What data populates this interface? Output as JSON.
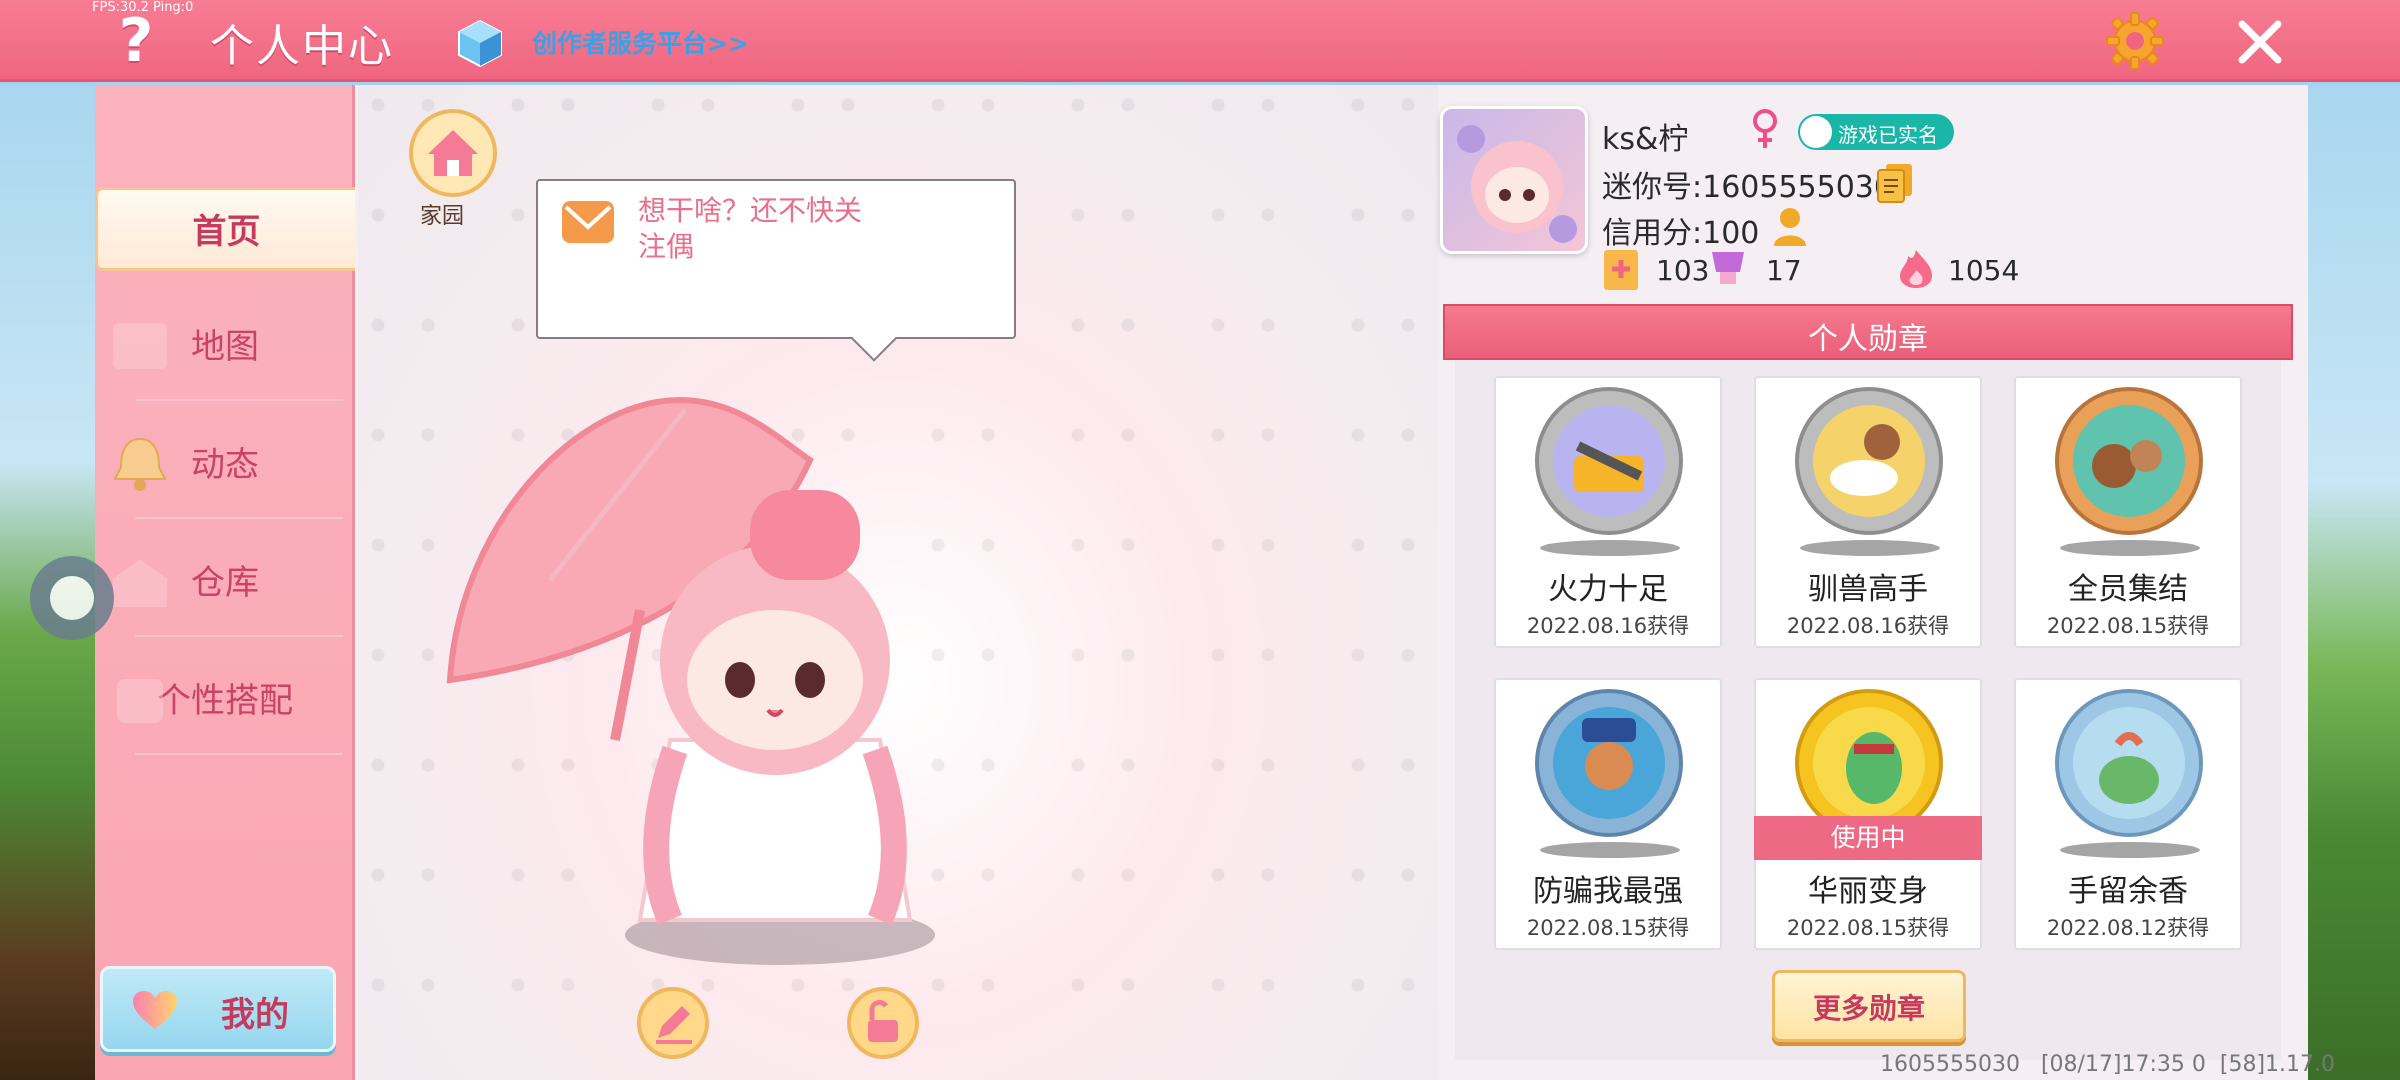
{
  "overlay": {
    "fps": "FPS:30.2  Ping:0"
  },
  "header": {
    "title": "个人中心",
    "creator_link": "创作者服务平台>>"
  },
  "sidebar": {
    "items": [
      {
        "label": "首页",
        "active": true
      },
      {
        "label": "地图",
        "active": false
      },
      {
        "label": "动态",
        "active": false
      },
      {
        "label": "仓库",
        "active": false
      },
      {
        "label": "个性搭配",
        "active": false
      }
    ],
    "my_button": "我的"
  },
  "stage": {
    "home_label": "家园",
    "bubble_text": "想干啥？还不快关注偶"
  },
  "profile": {
    "name": "ks&柠",
    "gender": "female",
    "verified": "游戏已实名",
    "mini_id": "迷你号:1605555030",
    "credit": "信用分:100",
    "stats": [
      {
        "icon": "favorites-icon",
        "value": "103"
      },
      {
        "icon": "trophy-icon",
        "value": "17"
      },
      {
        "icon": "popularity-flame-icon",
        "value": "1054"
      }
    ]
  },
  "medals": {
    "header": "个人勋章",
    "items": [
      {
        "name": "火力十足",
        "date": "2022.08.16获得",
        "in_use": false
      },
      {
        "name": "驯兽高手",
        "date": "2022.08.16获得",
        "in_use": false
      },
      {
        "name": "全员集结",
        "date": "2022.08.15获得",
        "in_use": false
      },
      {
        "name": "防骗我最强",
        "date": "2022.08.15获得",
        "in_use": false
      },
      {
        "name": "华丽变身",
        "date": "2022.08.15获得",
        "in_use": true,
        "in_use_label": "使用中"
      },
      {
        "name": "手留余香",
        "date": "2022.08.12获得",
        "in_use": false
      }
    ],
    "more_button": "更多勋章"
  },
  "footer": {
    "info": "1605555030   [08/17]17:35 0  [58]1.17.0"
  },
  "colors": {
    "accent": "#f06681",
    "sidebar": "#f9a6b2",
    "text_pink": "#c63a5d",
    "verified": "#1ab7a8"
  }
}
